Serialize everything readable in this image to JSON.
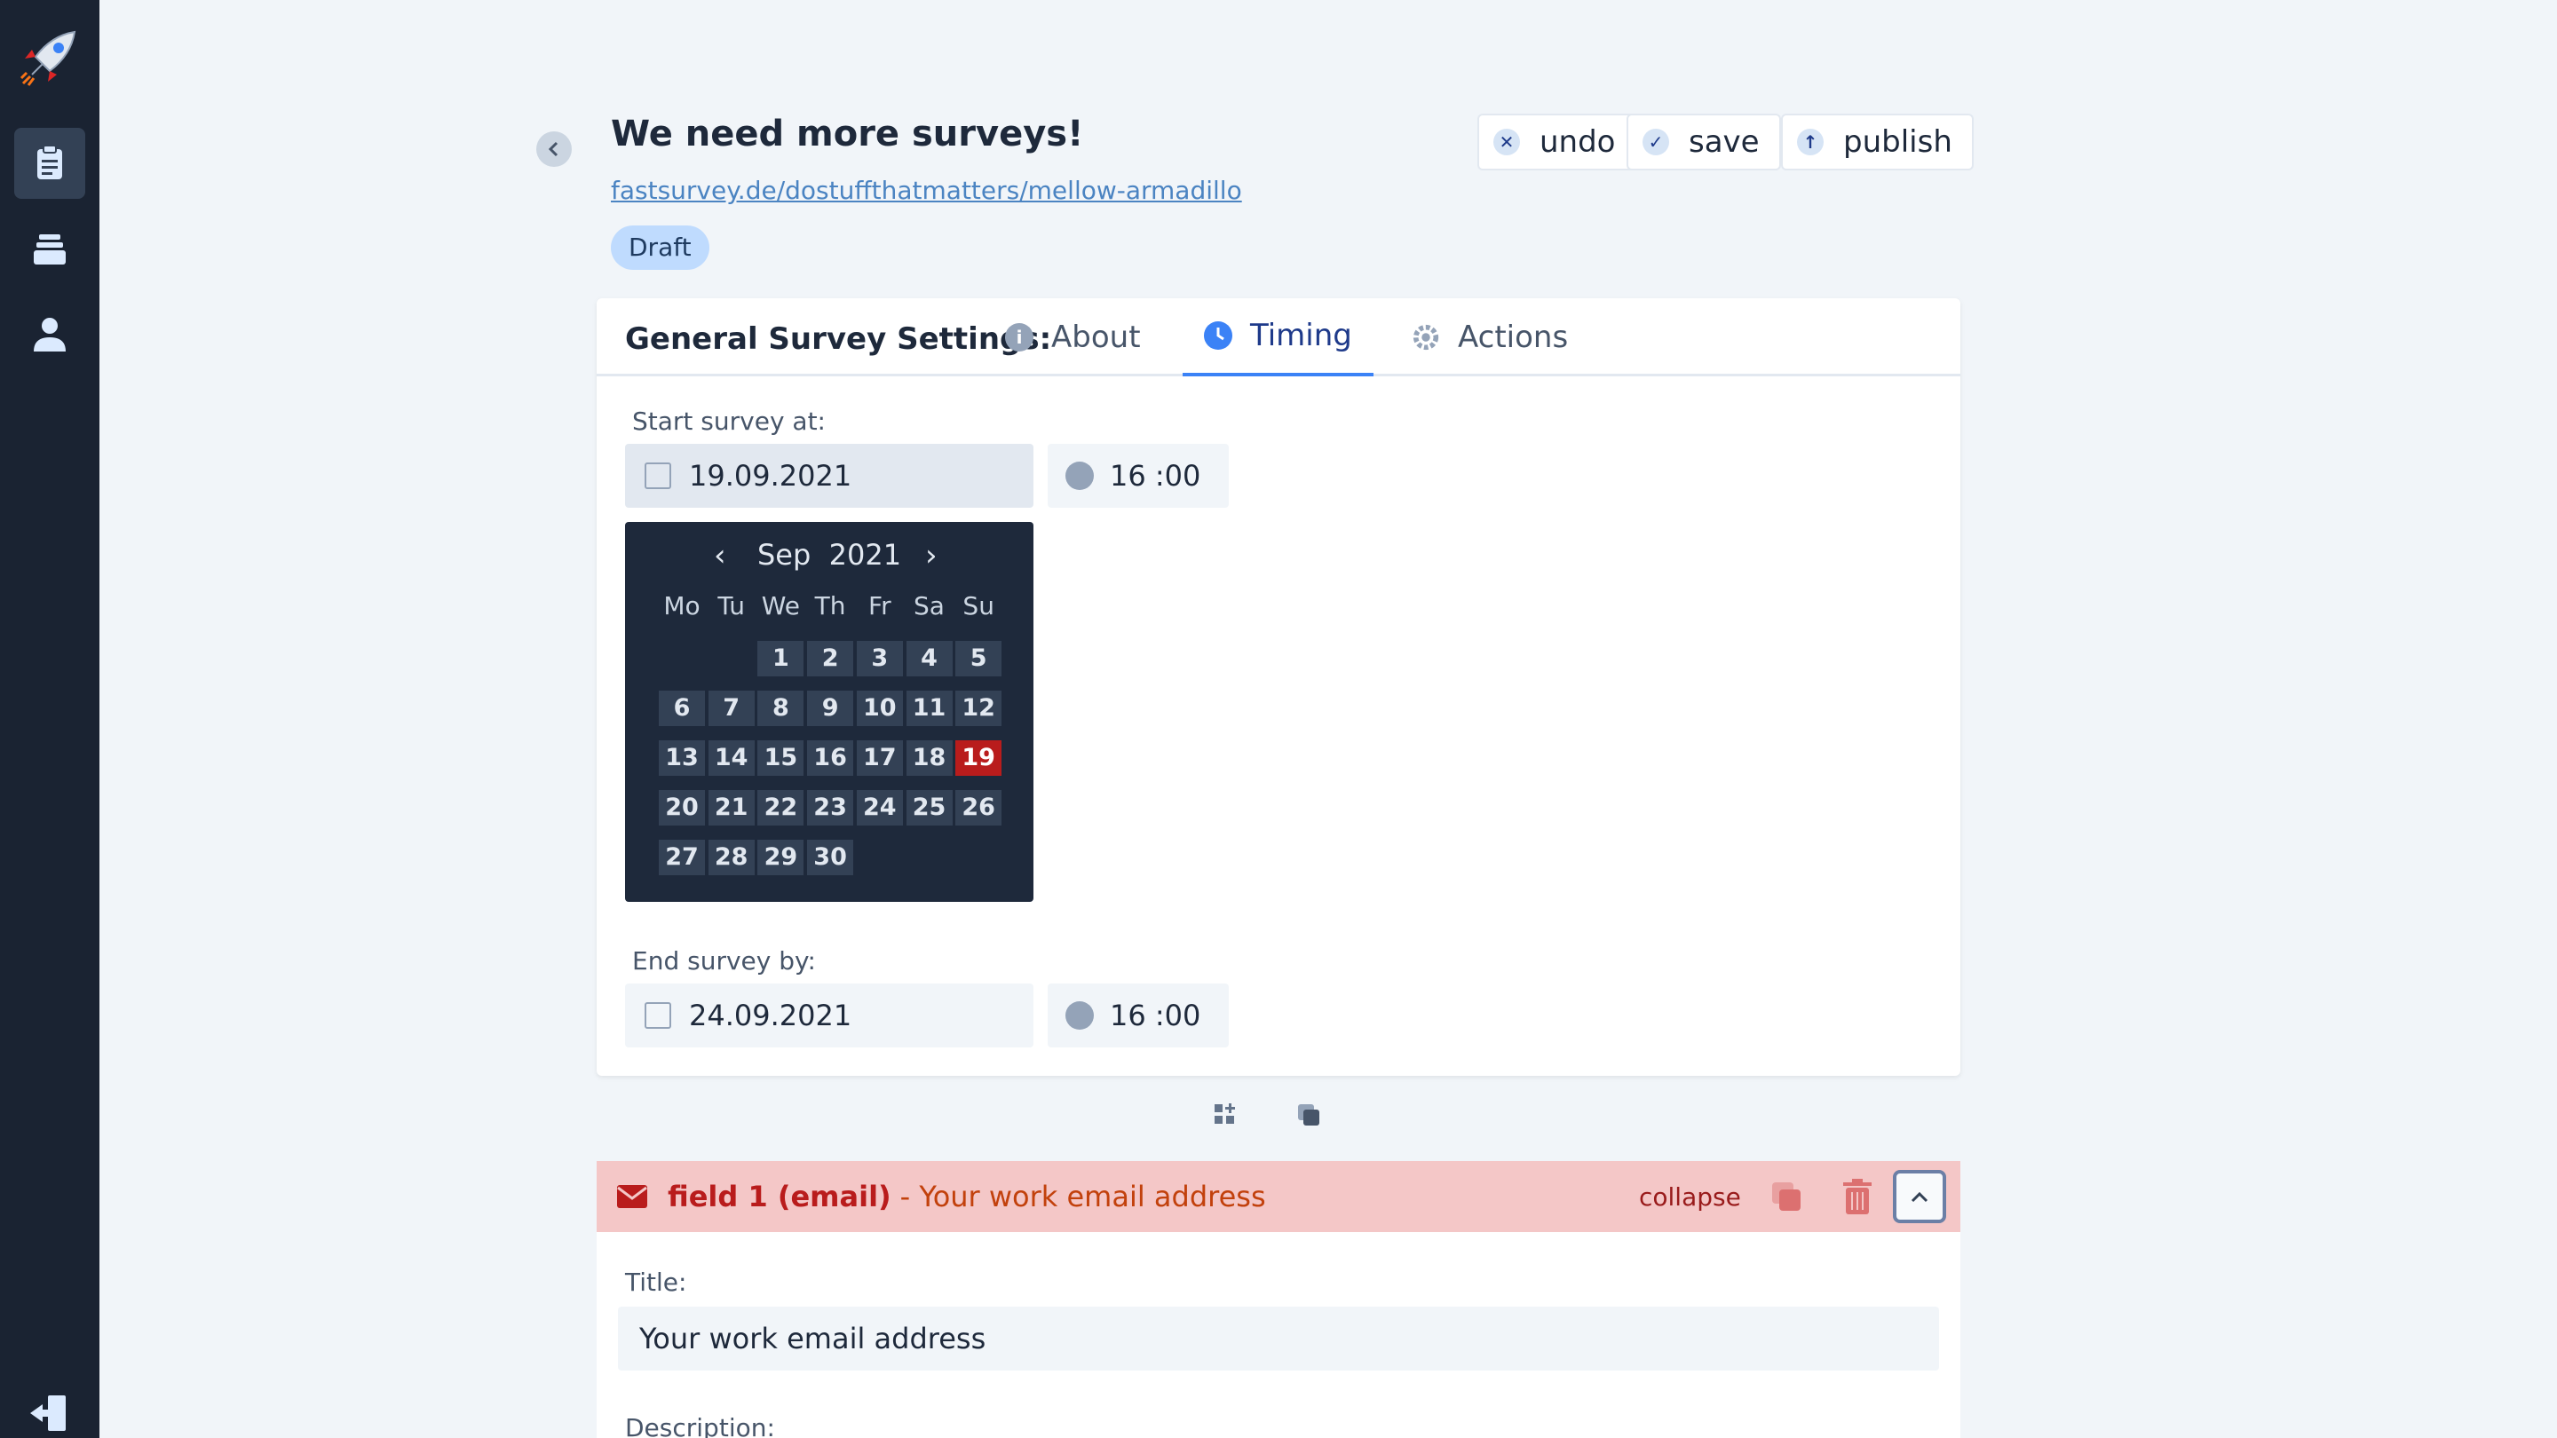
{
  "sidebar": {
    "items": [
      {
        "icon": "clipboard-icon",
        "active": true
      },
      {
        "icon": "stack-icon",
        "active": false
      },
      {
        "icon": "user-icon",
        "active": false
      }
    ],
    "logout_icon": "logout-icon"
  },
  "header": {
    "title": "We need more surveys!",
    "link": "fastsurvey.de/dostuffthatmatters/mellow-armadillo",
    "status": "Draft",
    "buttons": {
      "undo": "undo",
      "save": "save",
      "publish": "publish"
    }
  },
  "settings": {
    "heading": "General Survey Settings:",
    "tabs": [
      {
        "label": "About",
        "icon": "info-icon"
      },
      {
        "label": "Timing",
        "icon": "clock-icon",
        "active": true
      },
      {
        "label": "Actions",
        "icon": "gear-icon"
      }
    ],
    "start_label": "Start survey at:",
    "start_date": "19.09.2021",
    "start_time": "16 :00",
    "end_label": "End survey by:",
    "end_date": "24.09.2021",
    "end_time": "16 :00"
  },
  "calendar": {
    "month": "Sep",
    "year": "2021",
    "weekdays": [
      "Mo",
      "Tu",
      "We",
      "Th",
      "Fr",
      "Sa",
      "Su"
    ],
    "first_weekday_index": 2,
    "days_in_month": 30,
    "selected_day": 19
  },
  "field": {
    "title": "field 1 (email)",
    "subtitle": "- Your work email address",
    "collapse_label": "collapse",
    "title_label": "Title:",
    "title_value": "Your work email address",
    "description_label": "Description:"
  },
  "colors": {
    "sidebar": "#1a2332",
    "accent": "#3b82f6",
    "danger": "#b91c1c",
    "field_header": "#f4c7c7"
  }
}
